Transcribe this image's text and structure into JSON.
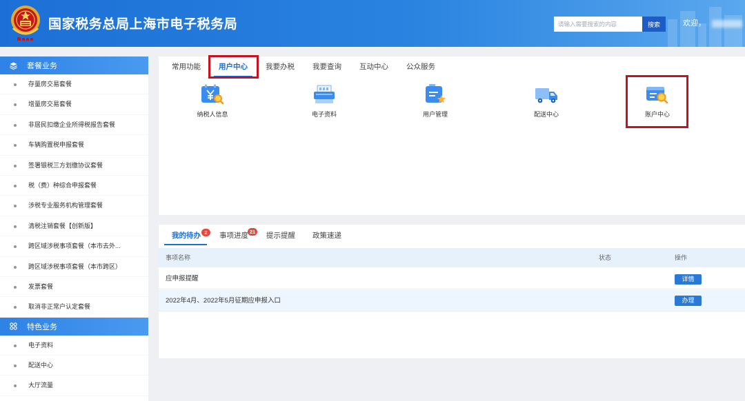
{
  "colors": {
    "header_start": "#1c6fd6",
    "header_end": "#5aa8ee",
    "primary": "#1a6fd4",
    "highlight": "#c8101e",
    "badge": "#e8473d",
    "sidebar_header": "#4a9af0",
    "table_header_bg": "#e7f1fc",
    "row_alt_bg": "#edf5fe",
    "page_bg": "#eef0f4"
  },
  "header": {
    "logo_icon": "tax-emblem-logo",
    "title": "国家税务总局上海市电子税务局",
    "search": {
      "placeholder": "请输入需要搜索的内容",
      "button_label": "搜索"
    },
    "welcome": "欢迎，"
  },
  "sidebar": {
    "sections": [
      {
        "title": "套餐业务",
        "icon": "layers-icon",
        "items": [
          "存量房交易套餐",
          "增量房交易套餐",
          "非居民扣缴企业所得税报告套餐",
          "车辆购置税申报套餐",
          "签署银税三方划缴协议套餐",
          "税（费）种综合申报套餐",
          "涉税专业服务机构管理套餐",
          "清税注销套餐【创新版】",
          "跨区域涉税事项套餐（本市去外...",
          "跨区域涉税事项套餐（本市跨区）",
          "发票套餐",
          "取消非正常户认定套餐"
        ]
      },
      {
        "title": "特色业务",
        "icon": "apps-icon",
        "items": [
          "电子资料",
          "配送中心",
          "大厅流量"
        ]
      }
    ]
  },
  "services_panel": {
    "tabs": [
      {
        "label": "常用功能",
        "active": false
      },
      {
        "label": "用户中心",
        "active": true
      },
      {
        "label": "我要办税",
        "active": false
      },
      {
        "label": "我要查询",
        "active": false
      },
      {
        "label": "互动中心",
        "active": false
      },
      {
        "label": "公众服务",
        "active": false
      }
    ],
    "shortcuts": [
      {
        "label": "纳税人信息",
        "icon": "taxpayer-info-icon"
      },
      {
        "label": "电子资料",
        "icon": "e-document-icon"
      },
      {
        "label": "用户管理",
        "icon": "user-management-icon"
      },
      {
        "label": "配送中心",
        "icon": "delivery-truck-icon"
      },
      {
        "label": "账户中心",
        "icon": "account-center-icon"
      }
    ]
  },
  "todo_panel": {
    "tabs": [
      {
        "label": "我的待办",
        "badge": "2",
        "active": true
      },
      {
        "label": "事项进度",
        "badge": "21",
        "active": false
      },
      {
        "label": "提示提醒",
        "active": false
      },
      {
        "label": "政策速递",
        "active": false
      }
    ],
    "table": {
      "columns": [
        "事项名称",
        "状态",
        "操作"
      ],
      "rows": [
        {
          "name": "应申报提醒",
          "action": "详情"
        },
        {
          "name": "2022年4月、2022年5月征期应申报入口",
          "action": "办理"
        }
      ]
    }
  }
}
